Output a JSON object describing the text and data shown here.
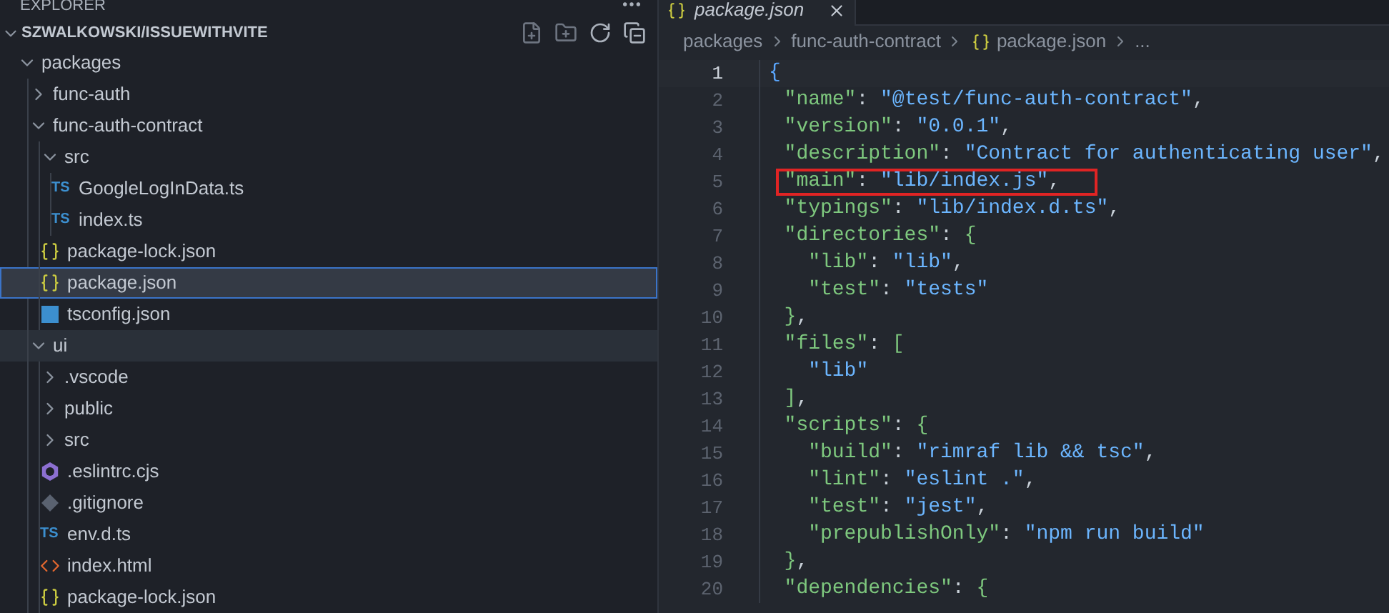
{
  "explorer": {
    "title": "EXPLORER",
    "root": {
      "label": "SZWALKOWSKI/ISSUEWITHVITE",
      "expanded": true
    },
    "tree": [
      {
        "label": "packages",
        "kind": "folder",
        "expanded": true,
        "selected": false,
        "hovered": false,
        "children": [
          {
            "label": "func-auth",
            "kind": "folder",
            "expanded": false,
            "selected": false,
            "hovered": false
          },
          {
            "label": "func-auth-contract",
            "kind": "folder",
            "expanded": true,
            "selected": false,
            "hovered": false,
            "children": [
              {
                "label": "src",
                "kind": "folder",
                "expanded": true,
                "selected": false,
                "hovered": false,
                "children": [
                  {
                    "label": "GoogleLogInData.ts",
                    "kind": "ts",
                    "badge": "TS",
                    "selected": false,
                    "hovered": false
                  },
                  {
                    "label": "index.ts",
                    "kind": "ts",
                    "badge": "TS",
                    "selected": false,
                    "hovered": false
                  }
                ]
              },
              {
                "label": "package-lock.json",
                "kind": "json",
                "selected": false,
                "hovered": false
              },
              {
                "label": "package.json",
                "kind": "json",
                "selected": true,
                "hovered": false
              },
              {
                "label": "tsconfig.json",
                "kind": "tsconfig",
                "selected": false,
                "hovered": false
              }
            ]
          },
          {
            "label": "ui",
            "kind": "folder",
            "expanded": true,
            "selected": false,
            "hovered": true,
            "children": [
              {
                "label": ".vscode",
                "kind": "folder",
                "expanded": false,
                "selected": false,
                "hovered": false
              },
              {
                "label": "public",
                "kind": "folder",
                "expanded": false,
                "selected": false,
                "hovered": false
              },
              {
                "label": "src",
                "kind": "folder",
                "expanded": false,
                "selected": false,
                "hovered": false
              },
              {
                "label": ".eslintrc.cjs",
                "kind": "eslint",
                "selected": false,
                "hovered": false
              },
              {
                "label": ".gitignore",
                "kind": "git",
                "selected": false,
                "hovered": false
              },
              {
                "label": "env.d.ts",
                "kind": "ts",
                "badge": "TS",
                "selected": false,
                "hovered": false
              },
              {
                "label": "index.html",
                "kind": "html",
                "selected": false,
                "hovered": false
              },
              {
                "label": "package-lock.json",
                "kind": "json",
                "selected": false,
                "hovered": false
              }
            ]
          }
        ]
      }
    ]
  },
  "editor": {
    "tab": {
      "label": "package.json",
      "preview": true
    },
    "breadcrumb": [
      {
        "label": "packages",
        "kind": "folder"
      },
      {
        "label": "func-auth-contract",
        "kind": "folder"
      },
      {
        "label": "package.json",
        "kind": "json"
      },
      {
        "label": "...",
        "kind": "more"
      }
    ],
    "lines": [
      {
        "number": "1",
        "current": true,
        "highlighted": false,
        "tokens": [
          {
            "t": "{",
            "kind": "bracket1"
          }
        ]
      },
      {
        "number": "2",
        "current": false,
        "highlighted": false,
        "tokens": [
          {
            "t": "\"name\"",
            "kind": "key"
          },
          {
            "t": ":",
            "kind": "punct"
          },
          {
            "t": "\"@test/func-auth-contract\"",
            "kind": "string"
          },
          {
            "t": ",",
            "kind": "punct"
          }
        ]
      },
      {
        "number": "3",
        "current": false,
        "highlighted": false,
        "tokens": [
          {
            "t": "\"version\"",
            "kind": "key"
          },
          {
            "t": ":",
            "kind": "punct"
          },
          {
            "t": "\"0.0.1\"",
            "kind": "string"
          },
          {
            "t": ",",
            "kind": "punct"
          }
        ]
      },
      {
        "number": "4",
        "current": false,
        "highlighted": false,
        "tokens": [
          {
            "t": "\"description\"",
            "kind": "key"
          },
          {
            "t": ":",
            "kind": "punct"
          },
          {
            "t": "\"Contract for authenticating user\"",
            "kind": "string"
          },
          {
            "t": ",",
            "kind": "punct"
          }
        ]
      },
      {
        "number": "5",
        "current": false,
        "highlighted": true,
        "tokens": [
          {
            "t": "\"main\"",
            "kind": "key"
          },
          {
            "t": ":",
            "kind": "punct"
          },
          {
            "t": "\"lib/index.js\"",
            "kind": "string"
          },
          {
            "t": ",",
            "kind": "punct"
          }
        ]
      },
      {
        "number": "6",
        "current": false,
        "highlighted": false,
        "tokens": [
          {
            "t": "\"typings\"",
            "kind": "key"
          },
          {
            "t": ":",
            "kind": "punct"
          },
          {
            "t": "\"lib/index.d.ts\"",
            "kind": "string"
          },
          {
            "t": ",",
            "kind": "punct"
          }
        ]
      },
      {
        "number": "7",
        "current": false,
        "highlighted": false,
        "tokens": [
          {
            "t": "\"directories\"",
            "kind": "key"
          },
          {
            "t": ":",
            "kind": "punct"
          },
          {
            "t": "{",
            "kind": "bracket2"
          }
        ]
      },
      {
        "number": "8",
        "current": false,
        "highlighted": false,
        "tokens": [
          {
            "t": "\"lib\"",
            "kind": "key"
          },
          {
            "t": ":",
            "kind": "punct"
          },
          {
            "t": "\"lib\"",
            "kind": "string"
          },
          {
            "t": ",",
            "kind": "punct"
          }
        ]
      },
      {
        "number": "9",
        "current": false,
        "highlighted": false,
        "tokens": [
          {
            "t": "\"test\"",
            "kind": "key"
          },
          {
            "t": ":",
            "kind": "punct"
          },
          {
            "t": "\"tests\"",
            "kind": "string"
          }
        ]
      },
      {
        "number": "10",
        "current": false,
        "highlighted": false,
        "tokens": [
          {
            "t": "}",
            "kind": "bracket2"
          },
          {
            "t": ",",
            "kind": "punct"
          }
        ]
      },
      {
        "number": "11",
        "current": false,
        "highlighted": false,
        "tokens": [
          {
            "t": "\"files\"",
            "kind": "key"
          },
          {
            "t": ":",
            "kind": "punct"
          },
          {
            "t": "[",
            "kind": "bracket2"
          }
        ]
      },
      {
        "number": "12",
        "current": false,
        "highlighted": false,
        "tokens": [
          {
            "t": "\"lib\"",
            "kind": "string"
          }
        ]
      },
      {
        "number": "13",
        "current": false,
        "highlighted": false,
        "tokens": [
          {
            "t": "]",
            "kind": "bracket2"
          },
          {
            "t": ",",
            "kind": "punct"
          }
        ]
      },
      {
        "number": "14",
        "current": false,
        "highlighted": false,
        "tokens": [
          {
            "t": "\"scripts\"",
            "kind": "key"
          },
          {
            "t": ":",
            "kind": "punct"
          },
          {
            "t": "{",
            "kind": "bracket2"
          }
        ]
      },
      {
        "number": "15",
        "current": false,
        "highlighted": false,
        "tokens": [
          {
            "t": "\"build\"",
            "kind": "key"
          },
          {
            "t": ":",
            "kind": "punct"
          },
          {
            "t": "\"rimraf lib && tsc\"",
            "kind": "string"
          },
          {
            "t": ",",
            "kind": "punct"
          }
        ]
      },
      {
        "number": "16",
        "current": false,
        "highlighted": false,
        "tokens": [
          {
            "t": "\"lint\"",
            "kind": "key"
          },
          {
            "t": ":",
            "kind": "punct"
          },
          {
            "t": "\"eslint .\"",
            "kind": "string"
          },
          {
            "t": ",",
            "kind": "punct"
          }
        ]
      },
      {
        "number": "17",
        "current": false,
        "highlighted": false,
        "tokens": [
          {
            "t": "\"test\"",
            "kind": "key"
          },
          {
            "t": ":",
            "kind": "punct"
          },
          {
            "t": "\"jest\"",
            "kind": "string"
          },
          {
            "t": ",",
            "kind": "punct"
          }
        ]
      },
      {
        "number": "18",
        "current": false,
        "highlighted": false,
        "tokens": [
          {
            "t": "\"prepublishOnly\"",
            "kind": "key"
          },
          {
            "t": ":",
            "kind": "punct"
          },
          {
            "t": "\"npm run build\"",
            "kind": "string"
          }
        ]
      },
      {
        "number": "19",
        "current": false,
        "highlighted": false,
        "tokens": [
          {
            "t": "}",
            "kind": "bracket2"
          },
          {
            "t": ",",
            "kind": "punct"
          }
        ]
      },
      {
        "number": "20",
        "current": false,
        "highlighted": false,
        "tokens": [
          {
            "t": "\"dependencies\"",
            "kind": "key"
          },
          {
            "t": ":",
            "kind": "punct"
          },
          {
            "t": "{",
            "kind": "bracket2"
          }
        ]
      }
    ]
  }
}
